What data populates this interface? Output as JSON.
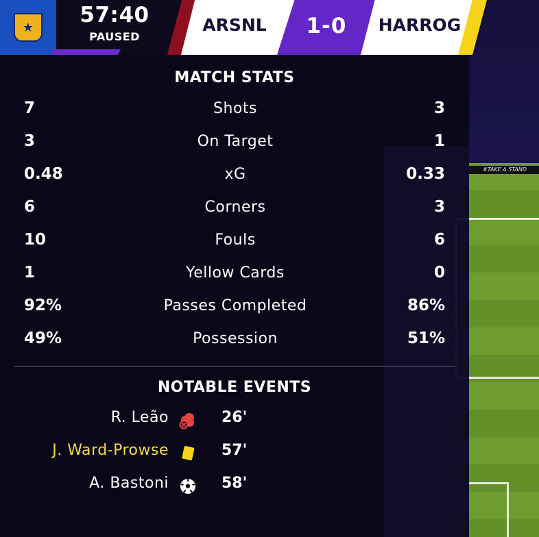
{
  "scoreboard": {
    "competition_icon": "trophy-shield-icon",
    "clock": "57:40",
    "status": "PAUSED",
    "home_team": "ARSNL",
    "score": "1-0",
    "away_team": "HARROG",
    "colors": {
      "home_stripe": "#8e1020",
      "away_stripe": "#f5d419",
      "score_bg": "#6426c6",
      "logo_bg": "#1a4fc0"
    }
  },
  "background": {
    "board_text": "#TAKE A STAND"
  },
  "match_stats": {
    "title": "MATCH STATS",
    "rows": [
      {
        "home": "7",
        "label": "Shots",
        "away": "3"
      },
      {
        "home": "3",
        "label": "On Target",
        "away": "1"
      },
      {
        "home": "0.48",
        "label": "xG",
        "away": "0.33"
      },
      {
        "home": "6",
        "label": "Corners",
        "away": "3"
      },
      {
        "home": "10",
        "label": "Fouls",
        "away": "6"
      },
      {
        "home": "1",
        "label": "Yellow Cards",
        "away": "0"
      },
      {
        "home": "92%",
        "label": "Passes Completed",
        "away": "86%"
      },
      {
        "home": "49%",
        "label": "Possession",
        "away": "51%"
      }
    ]
  },
  "notable_events": {
    "title": "NOTABLE EVENTS",
    "events": [
      {
        "player": "R. Leão",
        "icon": "injury-icon",
        "minute": "26'"
      },
      {
        "player": "J. Ward-Prowse",
        "icon": "yellow-card-icon",
        "minute": "57'"
      },
      {
        "player": "A. Bastoni",
        "icon": "goal-ball-icon",
        "minute": "58'"
      }
    ]
  }
}
